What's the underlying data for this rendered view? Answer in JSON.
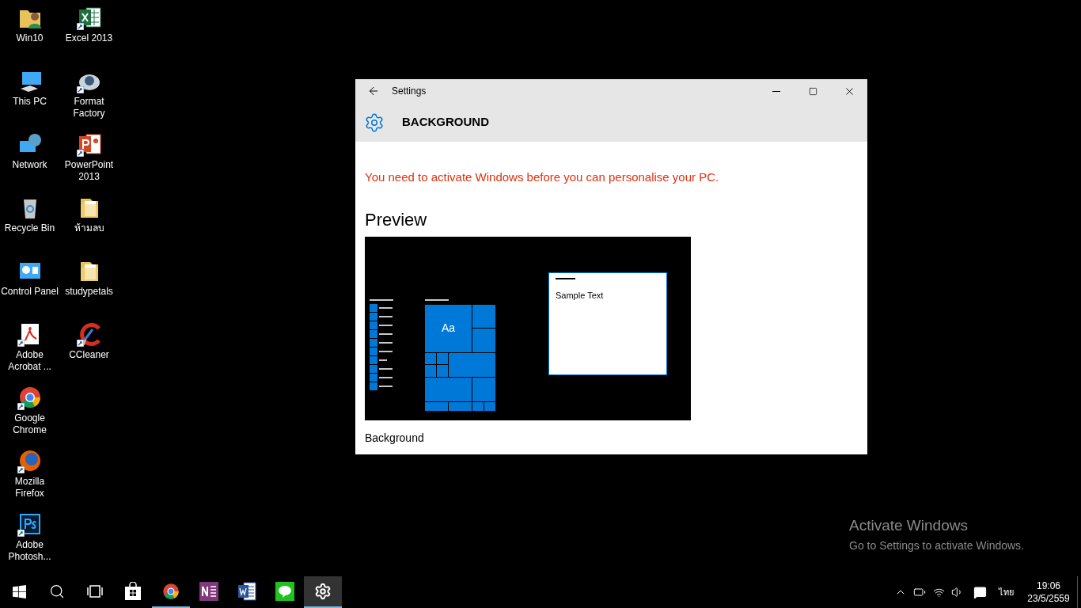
{
  "desktop_icons": [
    {
      "label": "Win10",
      "kind": "user-folder",
      "shortcut": false
    },
    {
      "label": "This PC",
      "kind": "pc",
      "shortcut": false
    },
    {
      "label": "Network",
      "kind": "network",
      "shortcut": false
    },
    {
      "label": "Recycle Bin",
      "kind": "recycle",
      "shortcut": false
    },
    {
      "label": "Control Panel",
      "kind": "control",
      "shortcut": false
    },
    {
      "label": "Adobe Acrobat ...",
      "kind": "pdf",
      "shortcut": true
    },
    {
      "label": "Google Chrome",
      "kind": "chrome",
      "shortcut": true
    },
    {
      "label": "Mozilla Firefox",
      "kind": "firefox",
      "shortcut": true
    },
    {
      "label": "Adobe Photosh...",
      "kind": "photoshop",
      "shortcut": true
    },
    {
      "label": "Excel 2013",
      "kind": "excel",
      "shortcut": true
    },
    {
      "label": "Format Factory",
      "kind": "disc",
      "shortcut": true
    },
    {
      "label": "PowerPoint 2013",
      "kind": "powerpoint",
      "shortcut": true
    },
    {
      "label": "ห้ามลบ",
      "kind": "folder",
      "shortcut": false
    },
    {
      "label": "studypetals",
      "kind": "folder",
      "shortcut": false
    },
    {
      "label": "CCleaner",
      "kind": "ccleaner",
      "shortcut": true
    }
  ],
  "window": {
    "title": "Settings",
    "page_title": "BACKGROUND",
    "warning": "You need to activate Windows before you can personalise your PC.",
    "preview_heading": "Preview",
    "preview": {
      "tile_text": "Aa",
      "sample_text": "Sample Text"
    },
    "section_label": "Background"
  },
  "watermark": {
    "title": "Activate Windows",
    "text": "Go to Settings to activate Windows."
  },
  "taskbar": {
    "items": [
      {
        "kind": "start",
        "running": false,
        "active": false
      },
      {
        "kind": "search",
        "running": false,
        "active": false
      },
      {
        "kind": "taskview",
        "running": false,
        "active": false
      },
      {
        "kind": "store",
        "running": false,
        "active": false
      },
      {
        "kind": "chrome",
        "running": true,
        "active": false
      },
      {
        "kind": "onenote",
        "running": false,
        "active": false
      },
      {
        "kind": "word",
        "running": false,
        "active": false
      },
      {
        "kind": "line",
        "running": false,
        "active": false
      },
      {
        "kind": "settings",
        "running": true,
        "active": true
      }
    ],
    "language": "ไทย",
    "time": "19:06",
    "date": "23/5/2559"
  }
}
